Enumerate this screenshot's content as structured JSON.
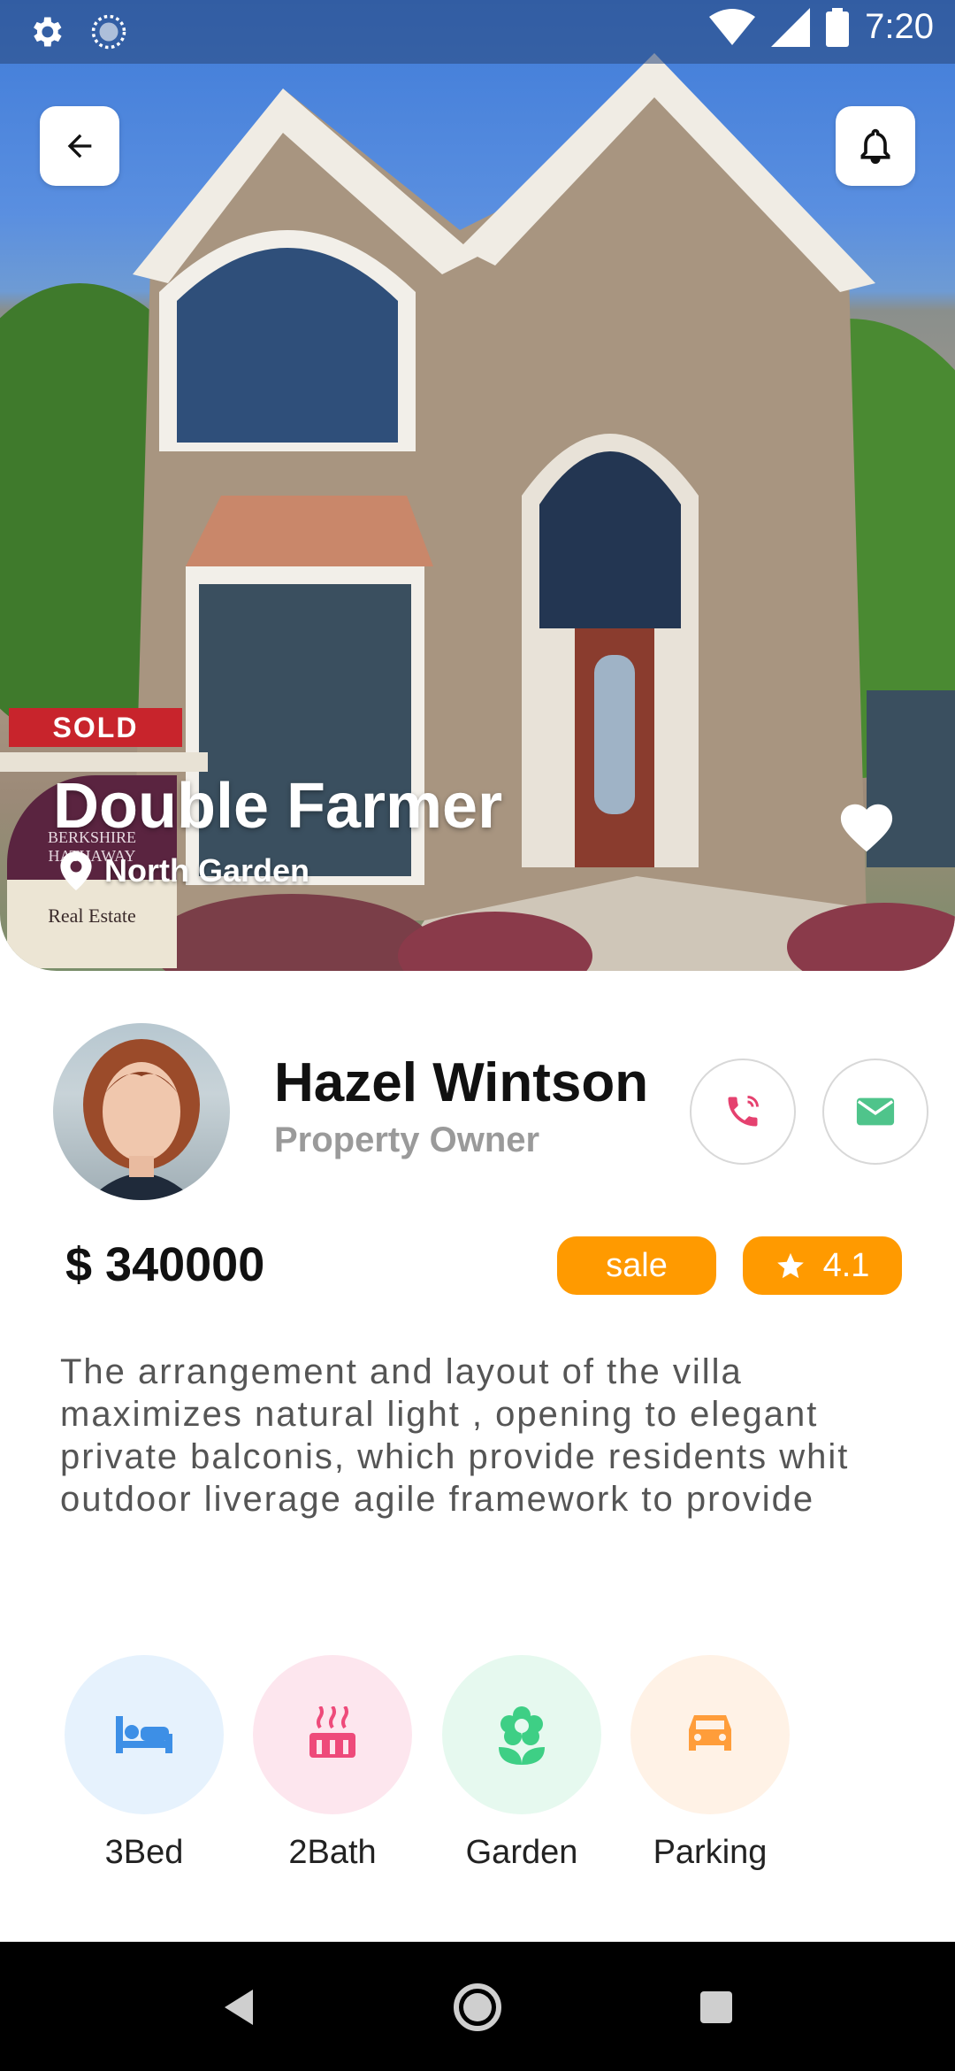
{
  "status_bar": {
    "time": "7:20"
  },
  "property": {
    "title": "Double Farmer",
    "location": "North Garden",
    "price": "$ 340000",
    "sale_label": "sale",
    "rating": "4.1",
    "description": "The arrangement and layout of the villa maximizes natural light , opening to elegant private balconis, which provide residents whit outdoor liverage agile framework to provide"
  },
  "sign": {
    "sold": "SOLD",
    "brand_line1": "BERKSHIRE",
    "brand_line2": "HATHAWAY",
    "sub": "Real Estate"
  },
  "owner": {
    "name": "Hazel Wintson",
    "role": "Property Owner"
  },
  "features": [
    {
      "label": "3Bed",
      "icon": "bed-icon",
      "bg": "#e6f2fd",
      "color": "#3d8fe6"
    },
    {
      "label": "2Bath",
      "icon": "bath-icon",
      "bg": "#fde6ee",
      "color": "#ee4a7a"
    },
    {
      "label": "Garden",
      "icon": "flower-icon",
      "bg": "#e6f9ef",
      "color": "#3ecf85"
    },
    {
      "label": "Parking",
      "icon": "car-icon",
      "bg": "#fff2e6",
      "color": "#ff9d3a"
    }
  ],
  "colors": {
    "accent": "#ff9a00",
    "phone": "#e5416f",
    "mail": "#4fc48b"
  }
}
